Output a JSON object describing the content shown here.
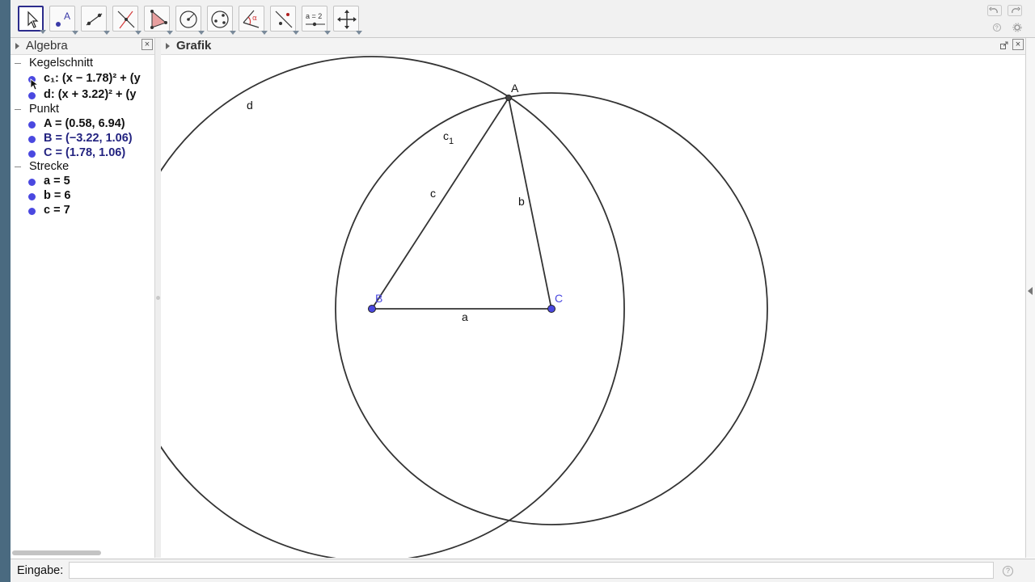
{
  "toolbar": {
    "tools": [
      {
        "name": "move-tool-icon",
        "selected": true
      },
      {
        "name": "point-tool-icon"
      },
      {
        "name": "line-tool-icon"
      },
      {
        "name": "perpendicular-line-tool-icon"
      },
      {
        "name": "polygon-tool-icon"
      },
      {
        "name": "circle-tool-icon"
      },
      {
        "name": "conic-tool-icon"
      },
      {
        "name": "angle-tool-icon"
      },
      {
        "name": "reflect-tool-icon"
      },
      {
        "name": "slider-tool-icon",
        "text": "a = 2"
      },
      {
        "name": "move-graphics-view-tool-icon"
      }
    ],
    "undo_icon": "undo-icon",
    "redo_icon": "redo-icon",
    "help_icon": "help-icon",
    "settings_icon": "gear-icon"
  },
  "algebra": {
    "title": "Algebra",
    "categories": [
      {
        "label": "Kegelschnitt",
        "items": [
          {
            "label": "c₁: (x − 1.78)² + (y"
          },
          {
            "label": "d: (x + 3.22)² + (y"
          }
        ]
      },
      {
        "label": "Punkt",
        "items": [
          {
            "label": "A = (0.58, 6.94)"
          },
          {
            "label": "B = (−3.22, 1.06)",
            "selected": true
          },
          {
            "label": "C = (1.78, 1.06)",
            "selected": true
          }
        ]
      },
      {
        "label": "Strecke",
        "items": [
          {
            "label": "a = 5"
          },
          {
            "label": "b = 6"
          },
          {
            "label": "c = 7"
          }
        ]
      }
    ]
  },
  "graphics": {
    "title": "Grafik",
    "labels": {
      "A": "A",
      "B": "B",
      "C": "C",
      "a": "a",
      "b": "b",
      "c": "c",
      "c1": "c",
      "c1_sub": "1",
      "d": "d"
    }
  },
  "input": {
    "label": "Eingabe:",
    "value": ""
  },
  "colors": {
    "point_fill": "#4a48e0",
    "selected_text": "#232380",
    "tool_selected_border": "#2c2c8c"
  }
}
